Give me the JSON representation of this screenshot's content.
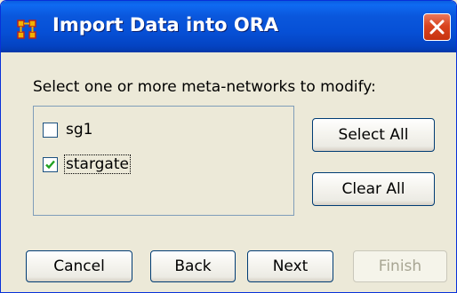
{
  "window": {
    "title": "Import Data into ORA",
    "close_icon": "close-icon",
    "app_icon": "ora-app-icon"
  },
  "instruction": "Select one or more meta-networks to modify:",
  "networks": [
    {
      "label": "sg1",
      "checked": false
    },
    {
      "label": "stargate",
      "checked": true
    }
  ],
  "buttons": {
    "select_all": "Select All",
    "clear_all": "Clear All",
    "cancel": "Cancel",
    "back": "Back",
    "next": "Next",
    "finish": "Finish",
    "finish_enabled": false
  },
  "colors": {
    "titlebar": "#0a57dc",
    "close_button": "#d9441f",
    "checkmark": "#21a121",
    "window_bg": "#ece9d8"
  }
}
